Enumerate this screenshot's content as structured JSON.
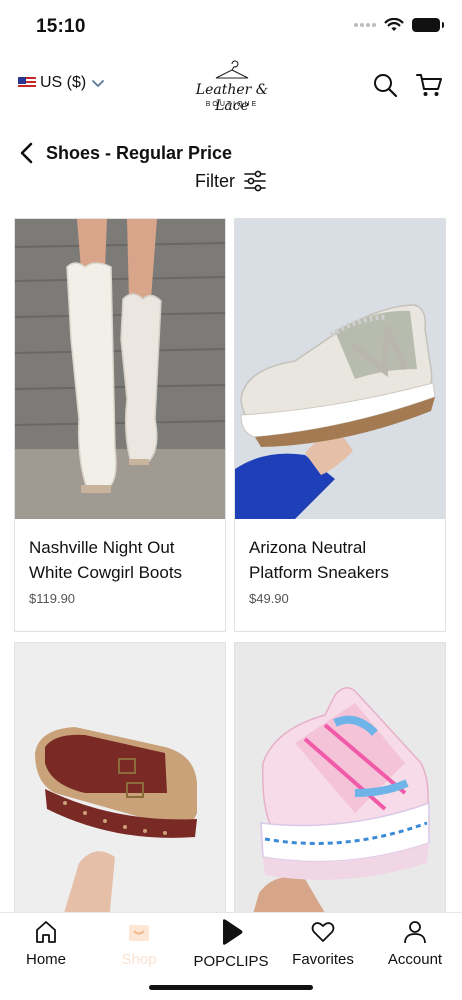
{
  "status_bar": {
    "time": "15:10"
  },
  "header": {
    "currency_label": "US ($)",
    "logo_text": "Leather & Lace",
    "logo_subtext": "BOUTIQUE"
  },
  "page": {
    "title": "Shoes - Regular Price",
    "filter_label": "Filter"
  },
  "products": [
    {
      "name": "Nashville Night Out White Cowgirl Boots",
      "price": "$119.90"
    },
    {
      "name": "Arizona Neutral Platform Sneakers",
      "price": "$49.90"
    },
    {
      "name": "",
      "price": ""
    },
    {
      "name": "",
      "price": ""
    }
  ],
  "tabbar": {
    "items": [
      {
        "label": "Home",
        "icon": "home-icon"
      },
      {
        "label": "Shop",
        "icon": "shop-icon"
      },
      {
        "label": "POPCLIPS",
        "icon": "play-icon"
      },
      {
        "label": "Favorites",
        "icon": "heart-icon"
      },
      {
        "label": "Account",
        "icon": "user-icon"
      }
    ]
  },
  "colors": {
    "accent": "#f3b88a",
    "text": "#111111",
    "border": "#e1e1e1"
  }
}
